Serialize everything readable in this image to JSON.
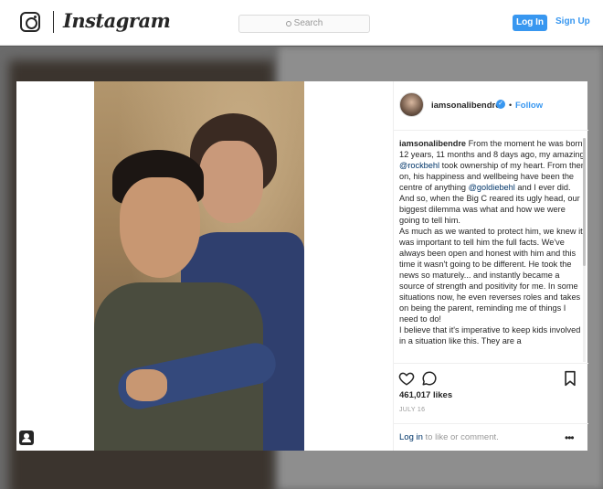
{
  "header": {
    "brand": "Instagram",
    "search_placeholder": "Search",
    "login_label": "Log In",
    "signup_label": "Sign Up"
  },
  "post": {
    "username": "iamsonalibendre",
    "follow_label": "Follow",
    "separator": "•",
    "caption": {
      "user": "iamsonalibendre",
      "seg1": " From the moment he was born 12 years, 11 months and 8 days ago, my amazing ",
      "mention1": "@rockbehl",
      "seg2": " took ownership of my heart. From then on, his happiness and wellbeing have been the centre of anything ",
      "mention2": "@goldiebehl",
      "seg3": " and I ever did. And so, when the Big C reared its ugly head, our biggest dilemma was what and how we were going to tell him.",
      "para2": "As much as we wanted to protect him, we knew it was important to tell him the full facts. We've always been open and honest with him and this time it wasn't going to be different. He took the news so maturely... and instantly became a source of strength and positivity for me. In some situations now, he even reverses roles and takes on being the parent, reminding me of things I need to do!",
      "para3": "I believe that it's imperative to keep kids involved in a situation like this. They are a"
    },
    "likes": "461,017 likes",
    "date": "JULY 16",
    "login_prompt_link": "Log in",
    "login_prompt_rest": " to like or comment.",
    "more_label": "•••"
  },
  "icons": {
    "logo": "instagram-camera-icon",
    "search": "search-icon",
    "verified": "verified-badge-icon",
    "like": "heart-icon",
    "comment": "comment-icon",
    "save": "bookmark-icon",
    "tag": "user-tag-icon",
    "more": "more-options-icon"
  },
  "colors": {
    "accent": "#3897f0",
    "text": "#262626",
    "muted": "#999999",
    "mention": "#003569"
  }
}
